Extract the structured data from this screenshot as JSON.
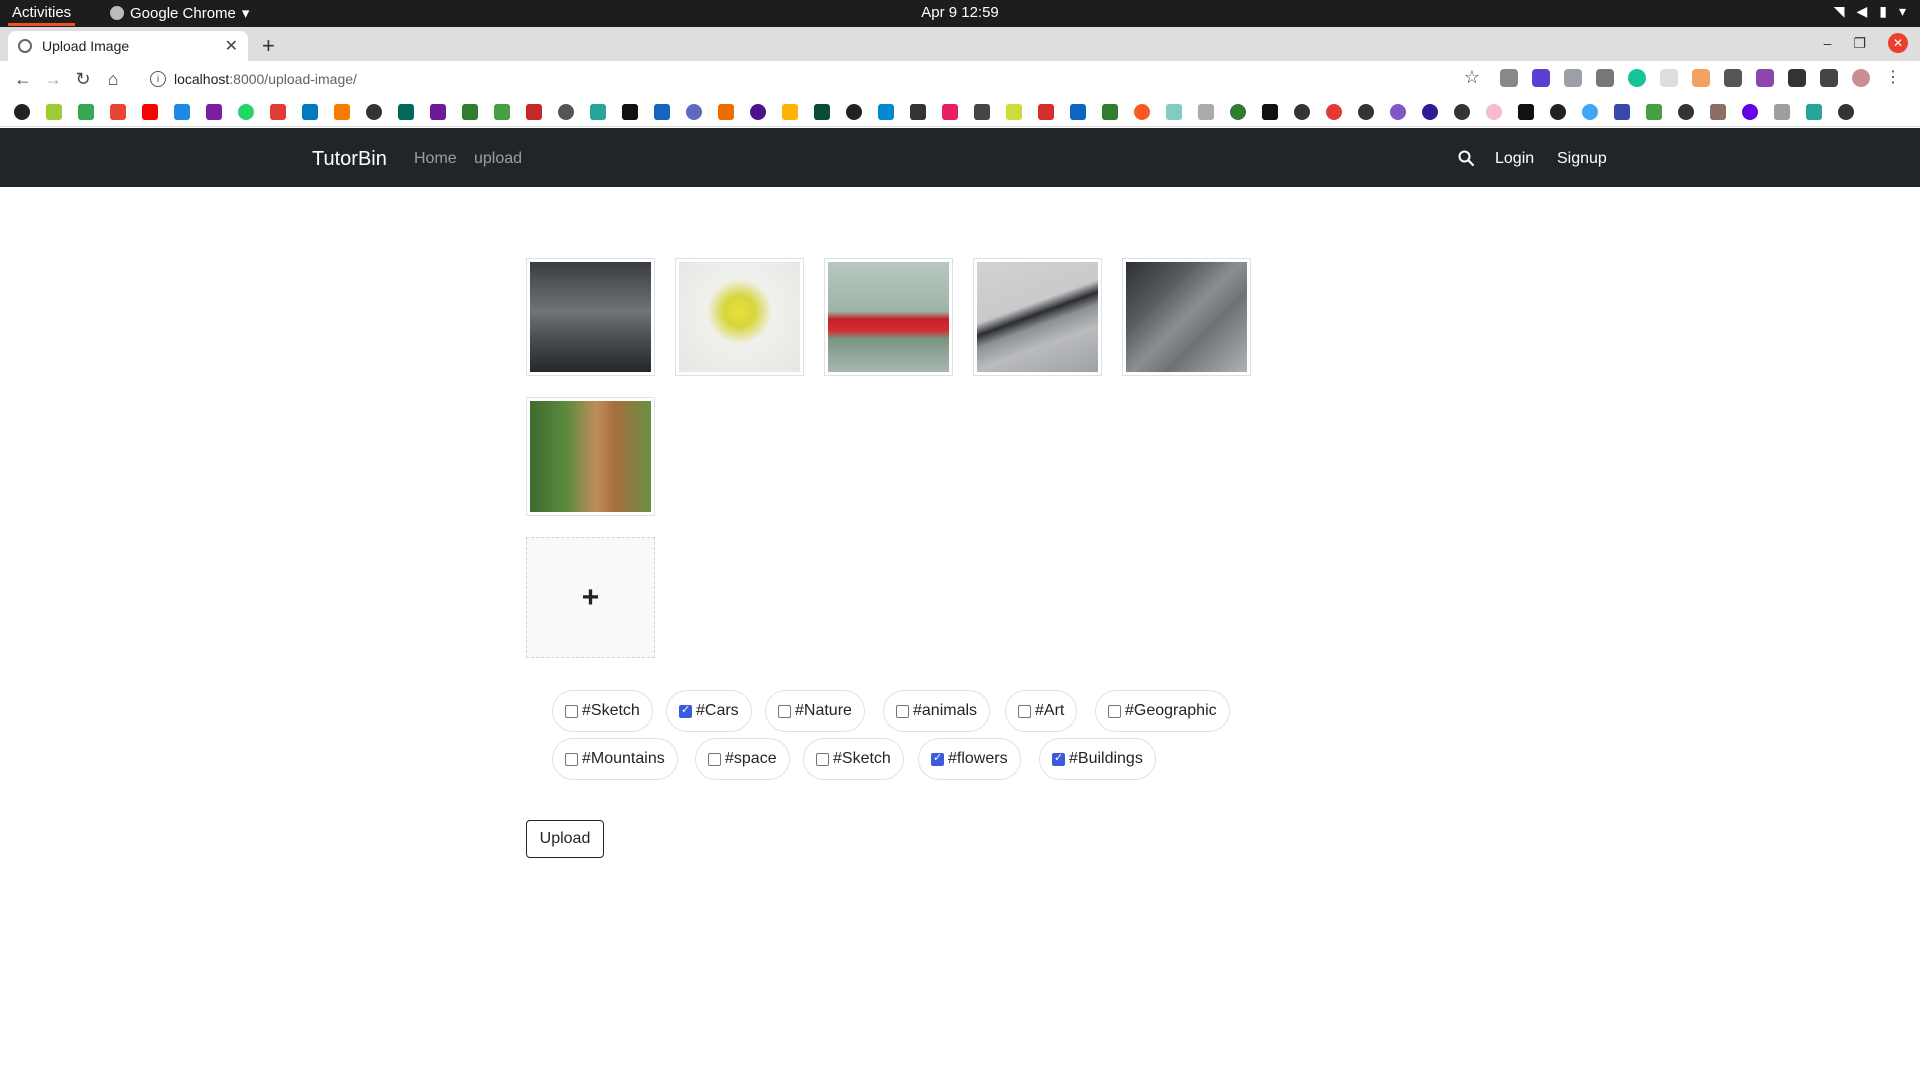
{
  "os": {
    "activities": "Activities",
    "app_name": "Google Chrome",
    "clock": "Apr 9  12:59"
  },
  "browser": {
    "tab_title": "Upload Image",
    "url_host": "localhost",
    "url_path": ":8000/upload-image/"
  },
  "site": {
    "brand": "TutorBin",
    "nav": {
      "home": "Home",
      "upload": "upload",
      "login": "Login",
      "signup": "Signup"
    }
  },
  "images": [
    {
      "subject": "office"
    },
    {
      "subject": "flower"
    },
    {
      "subject": "red car"
    },
    {
      "subject": "silver car"
    },
    {
      "subject": "silver car"
    },
    {
      "subject": "man with laptop"
    }
  ],
  "add_icon": "+",
  "tags": [
    {
      "label": "#Sketch",
      "checked": false
    },
    {
      "label": "#Cars",
      "checked": true
    },
    {
      "label": "#Nature",
      "checked": false
    },
    {
      "label": "#animals",
      "checked": false
    },
    {
      "label": "#Art",
      "checked": false
    },
    {
      "label": "#Geographic",
      "checked": false
    },
    {
      "label": "#Mountains",
      "checked": false
    },
    {
      "label": "#space",
      "checked": false
    },
    {
      "label": "#Sketch",
      "checked": false
    },
    {
      "label": "#flowers",
      "checked": true
    },
    {
      "label": "#Buildings",
      "checked": true
    }
  ],
  "upload_label": "Upload",
  "colors": {
    "navbar": "#212529",
    "checkbox_checked": "#3b5bdb",
    "activities_underline": "#e95420"
  }
}
